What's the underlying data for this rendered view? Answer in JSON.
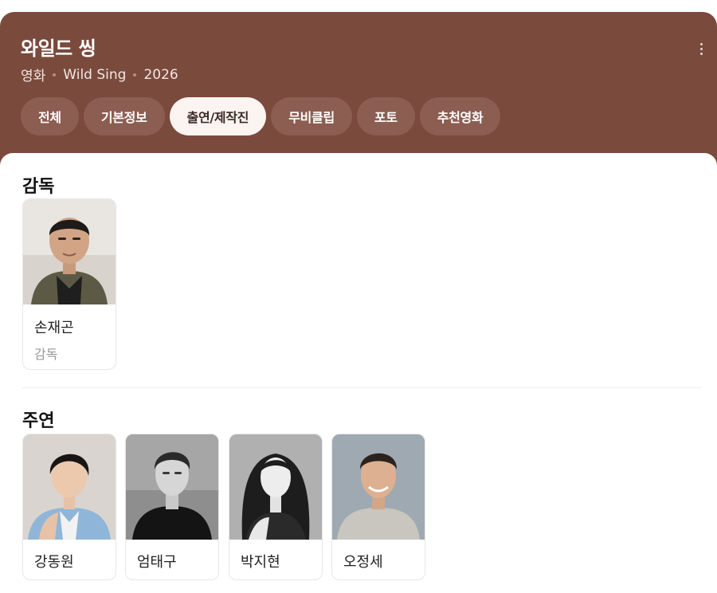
{
  "header": {
    "title": "와일드 씽",
    "meta": {
      "type": "영화",
      "english_title": "Wild Sing",
      "year": "2026"
    },
    "more_icon": "more-vertical-icon"
  },
  "tabs": [
    {
      "label": "전체",
      "active": false
    },
    {
      "label": "기본정보",
      "active": false
    },
    {
      "label": "출연/제작진",
      "active": true
    },
    {
      "label": "무비클립",
      "active": false
    },
    {
      "label": "포토",
      "active": false
    },
    {
      "label": "추천영화",
      "active": false
    }
  ],
  "directors": {
    "title": "감독",
    "people": [
      {
        "name": "손재곤",
        "role": "감독"
      }
    ]
  },
  "cast": {
    "title": "주연",
    "people": [
      {
        "name": "강동원"
      },
      {
        "name": "엄태구"
      },
      {
        "name": "박지현"
      },
      {
        "name": "오정세"
      }
    ]
  },
  "colors": {
    "header_bg": "#7a4a3d",
    "tab_bg": "#8c5d51",
    "tab_active_bg": "#fbf4f1"
  }
}
